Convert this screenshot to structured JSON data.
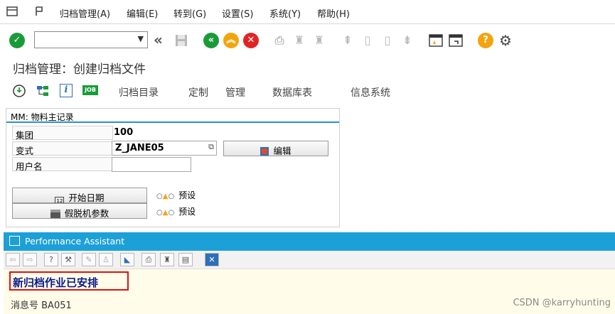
{
  "menubar": {
    "items": [
      "归档管理(A)",
      "编辑(E)",
      "转到(G)",
      "设置(S)",
      "系统(Y)",
      "帮助(H)"
    ]
  },
  "toolbar": {
    "command_value": "",
    "icons": [
      "check-icon",
      "back-nav-icon",
      "save-icon",
      "back-icon",
      "exit-icon",
      "cancel-icon",
      "print-icon",
      "find-icon",
      "find-next-icon",
      "first-page-icon",
      "prev-page-icon",
      "next-page-icon",
      "last-page-icon",
      "new-session-icon",
      "shortcut-icon",
      "help-icon",
      "settings-icon"
    ]
  },
  "title": "归档管理：创建归档文件",
  "app_toolbar": {
    "labels": [
      "归档目录",
      "定制",
      "管理",
      "数据库表",
      "信息系统"
    ],
    "job_badge": "JOB",
    "info_badge": "i"
  },
  "form": {
    "header": "MM: 物料主记录",
    "client_label": "集团",
    "client_value": "100",
    "variant_label": "变式",
    "variant_value": "Z_JANE05",
    "edit_button": "编辑",
    "user_label": "用户名",
    "user_value": "",
    "start_date_button": "开始日期",
    "start_date_status": "预设",
    "spool_button": "假脱机参数",
    "spool_status": "预设"
  },
  "performance_assistant": {
    "title": "Performance Assistant",
    "message": "新归档作业已安排",
    "message_number": "消息号 BA051"
  },
  "watermark": "CSDN @karryhunting",
  "colors": {
    "accent_blue": "#1da0d8",
    "highlight_red": "#e01010",
    "message_text": "#0b1a8a",
    "ok_green": "#1a9b3a",
    "cancel_red": "#e02424",
    "warn_orange": "#f3a40c"
  }
}
